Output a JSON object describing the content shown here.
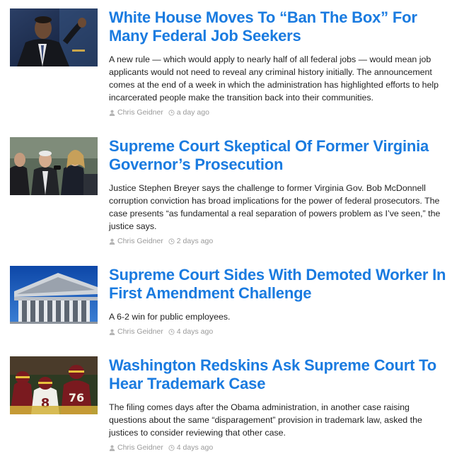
{
  "articles": [
    {
      "headline": "White House Moves To “Ban The Box” For Many Federal Job Seekers",
      "summary": "A new rule — which would apply to nearly half of all federal jobs — would mean job applicants would not need to reveal any criminal history initially. The announcement comes at the end of a week in which the administration has highlighted efforts to help incarcerated people make the transition back into their communities.",
      "author": "Chris Geidner",
      "time": "a day ago",
      "image": "obama-speaking-photo"
    },
    {
      "headline": "Supreme Court Skeptical Of Former Virginia Governor’s Prosecution",
      "summary": "Justice Stephen Breyer says the challenge to former Virginia Gov. Bob McDonnell corruption conviction has broad implications for the power of federal prosecutors. The case presents “as fundamental a real separation of powers problem as I’ve seen,” the justice says.",
      "author": "Chris Geidner",
      "time": "2 days ago",
      "image": "mcdonnell-press-photo"
    },
    {
      "headline": "Supreme Court Sides With Demoted Worker In First Amendment Challenge",
      "summary": "A 6-2 win for public employees.",
      "author": "Chris Geidner",
      "time": "4 days ago",
      "image": "supreme-court-building-photo"
    },
    {
      "headline": "Washington Redskins Ask Supreme Court To Hear Trademark Case",
      "summary": "The filing comes days after the Obama administration, in another case raising questions about the same “disparagement” provision in trademark law, asked the justices to consider reviewing that other case.",
      "author": "Chris Geidner",
      "time": "4 days ago",
      "image": "redskins-football-photo"
    }
  ],
  "colors": {
    "headline": "#1a7be0",
    "body_text": "#222222",
    "meta_text": "#9a9a9a"
  },
  "icons": {
    "author": "person-icon",
    "time": "clock-icon"
  }
}
